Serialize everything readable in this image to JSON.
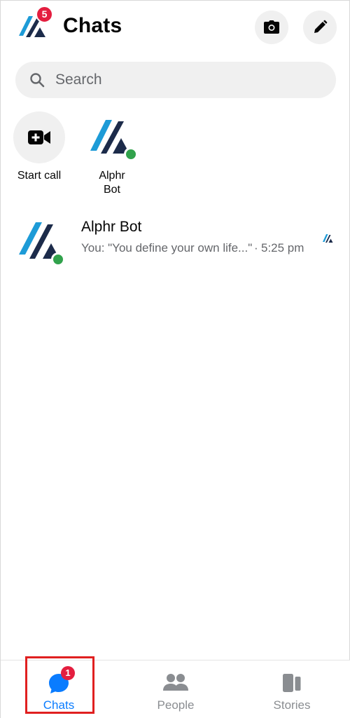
{
  "header": {
    "title": "Chats",
    "logo_badge": "5",
    "camera_icon": "camera-icon",
    "edit_icon": "pencil-icon"
  },
  "search": {
    "placeholder": "Search",
    "icon": "search-icon"
  },
  "active_row": {
    "start_call_label": "Start call",
    "start_call_icon": "video-plus-icon",
    "contacts": [
      {
        "name": "Alphr Bot",
        "online": true
      }
    ]
  },
  "chats": [
    {
      "name": "Alphr Bot",
      "preview": "You: \"You define your own life...\"",
      "separator": "·",
      "time": "5:25 pm",
      "online": true
    }
  ],
  "tabs": [
    {
      "label": "Chats",
      "icon": "chat-bubble-icon",
      "badge": "1",
      "active": true
    },
    {
      "label": "People",
      "icon": "people-icon",
      "active": false
    },
    {
      "label": "Stories",
      "icon": "stories-icon",
      "active": false
    }
  ],
  "colors": {
    "accent": "#0a7cff",
    "badge": "#e41e3f",
    "online": "#31a24c",
    "logo_dark": "#1c2b4a",
    "logo_blue": "#1d9bd7",
    "highlight": "#e02020"
  }
}
